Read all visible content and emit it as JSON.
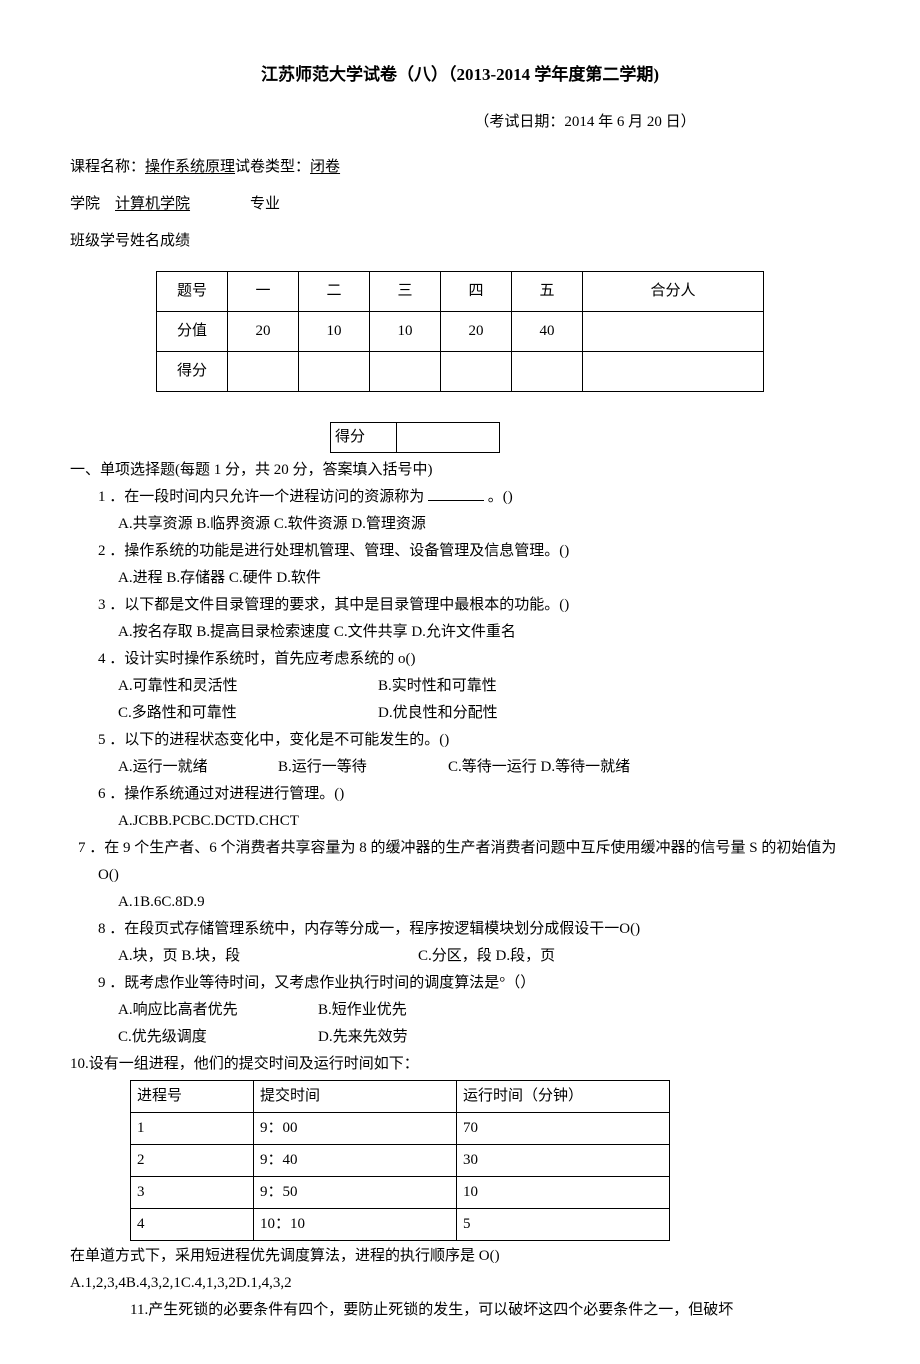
{
  "title": "江苏师范大学试卷（八）（2013-2014 学年度第二学期)",
  "exam_date": "（考试日期：2014 年 6 月 20 日）",
  "meta": {
    "course_label": "课程名称：",
    "course_name": "操作系统原理",
    "paper_type_label": "试卷类型：",
    "paper_type": "闭卷",
    "college_label": "学院",
    "college_name": "计算机学院",
    "major_label": "专业",
    "line3": "班级学号姓名成绩"
  },
  "score_table": {
    "headers": [
      "题号",
      "一",
      "二",
      "三",
      "四",
      "五",
      "合分人"
    ],
    "row_value_label": "分值",
    "values": [
      "20",
      "10",
      "10",
      "20",
      "40",
      ""
    ],
    "row_score_label": "得分"
  },
  "defen_label": "得分",
  "section1": {
    "head": "一、单项选择题(每题 1 分，共 20 分，答案填入括号中)",
    "q1": {
      "text_a": "1 ．在一段时间内只允许一个进程访问的资源称为 ",
      "text_b": " 。()",
      "opts": "A.共享资源 B.临界资源 C.软件资源 D.管理资源"
    },
    "q2": {
      "text": "2 ．操作系统的功能是进行处理机管理、管理、设备管理及信息管理。()",
      "opts": "A.进程 B.存储器 C.硬件 D.软件"
    },
    "q3": {
      "text": "3 ．以下都是文件目录管理的要求，其中是目录管理中最根本的功能。()",
      "opts": "A.按名存取 B.提高目录检索速度 C.文件共享 D.允许文件重名"
    },
    "q4": {
      "text": "4 ．设计实时操作系统时，首先应考虑系统的 o()",
      "a": "A.可靠性和灵活性",
      "b": "B.实时性和可靠性",
      "c": "C.多路性和可靠性",
      "d": "D.优良性和分配性"
    },
    "q5": {
      "text": "5 ．以下的进程状态变化中，变化是不可能发生的。()",
      "a": "A.运行一就绪",
      "b": "B.运行一等待",
      "c": "C.等待一运行 D.等待一就绪"
    },
    "q6": {
      "text": "6 ．操作系统通过对进程进行管理。()",
      "opts": "A.JCBB.PCBC.DCTD.CHCT"
    },
    "q7": {
      "text": "7 ．在 9 个生产者、6 个消费者共享容量为 8 的缓冲器的生产者消费者问题中互斥使用缓冲器的信号量 S 的初始值为 O()",
      "opts": "A.1B.6C.8D.9"
    },
    "q8": {
      "text": "8 ．在段页式存储管理系统中，内存等分成一，程序按逻辑模块划分成假设干一O()",
      "a": "A.块，页 B.块，段",
      "b": "C.分区，段 D.段，页"
    },
    "q9": {
      "text": "9 ．既考虑作业等待时间，又考虑作业执行时间的调度算法是°（）",
      "a": "A.响应比高者优先",
      "b": "B.短作业优先",
      "c": "C.优先级调度",
      "d": "D.先来先效劳"
    },
    "q10": {
      "text": "10.设有一组进程，他们的提交时间及运行时间如下：",
      "headers": [
        "进程号",
        "提交时间",
        "运行时间（分钟）"
      ],
      "rows": [
        [
          "1",
          "9：00",
          "70"
        ],
        [
          "2",
          "9：40",
          "30"
        ],
        [
          "3",
          "9：50",
          "10"
        ],
        [
          "4",
          "10：10",
          "5"
        ]
      ],
      "tail": "在单道方式下，采用短进程优先调度算法，进程的执行顺序是 O()",
      "opts": "A.1,2,3,4B.4,3,2,1C.4,1,3,2D.1,4,3,2"
    },
    "q11": {
      "text": "11.产生死锁的必要条件有四个，要防止死锁的发生，可以破坏这四个必要条件之一，但破坏"
    }
  }
}
